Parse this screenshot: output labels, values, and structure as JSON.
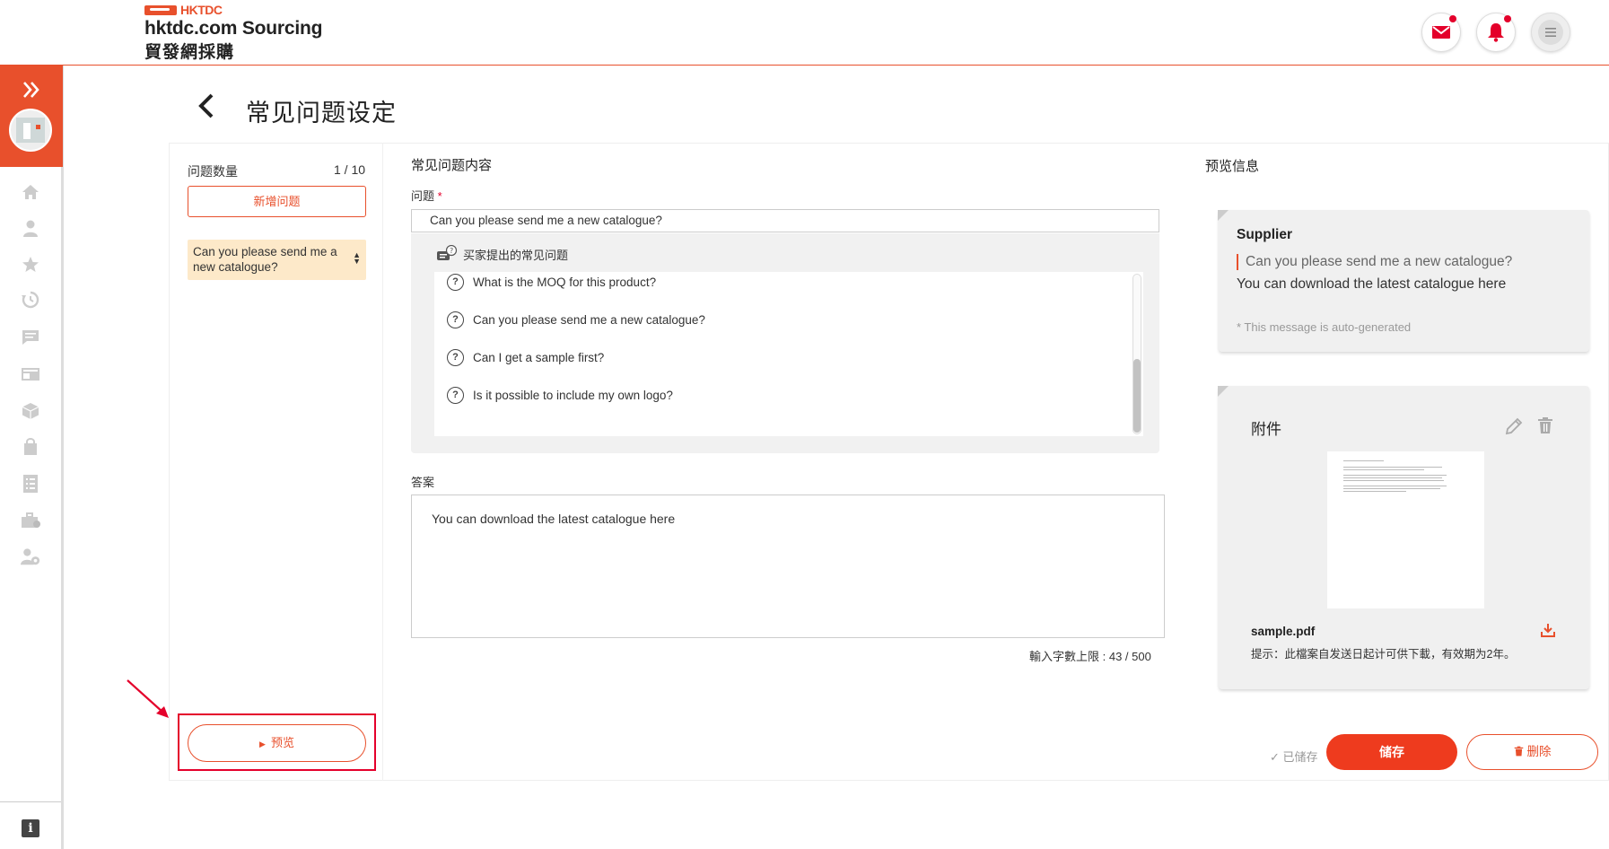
{
  "header": {
    "logo_brand": "HKTDC",
    "logo_en": "hktdc.com Sourcing",
    "logo_zh": "貿發網採購",
    "icons": [
      "mail-icon",
      "bell-icon",
      "menu-icon"
    ],
    "accent_color": "#e8502c",
    "notification_dot_color": "#e4002b"
  },
  "rail": {
    "icons": [
      "expand-icon",
      "home-icon",
      "user-icon",
      "star-icon",
      "history-icon",
      "message-icon",
      "product-icon",
      "box-icon",
      "bag-icon",
      "list-icon",
      "briefcase-icon",
      "user-settings-icon",
      "info-icon"
    ]
  },
  "page": {
    "title": "常见问题设定"
  },
  "list_panel": {
    "count_label": "问题数量",
    "count_value": "1 / 10",
    "add_button": "新增问题",
    "items": [
      {
        "label": "Can you please send me a new catalogue?"
      }
    ],
    "preview_button": "预览"
  },
  "content_panel": {
    "section_title": "常见问题内容",
    "question_label": "问题",
    "required_mark": "*",
    "question_value": "Can you please send me a new catalogue?",
    "suggest_title": "买家提出的常见问题",
    "suggestions": [
      "What is the MOQ for this product?",
      "Can you please send me a new catalogue?",
      "Can I get a sample first?",
      "Is it possible to include my own logo?"
    ],
    "answer_label": "答案",
    "answer_value": "You can download the latest catalogue here",
    "char_limit": "輸入字數上限 : 43 / 500"
  },
  "preview_panel": {
    "section_title": "预览信息",
    "supplier_label": "Supplier",
    "preview_question": "Can you please send me a new catalogue?",
    "preview_answer": "You can download the latest catalogue here",
    "auto_note": "* This message is auto-generated",
    "attachment_title": "附件",
    "file_name": "sample.pdf",
    "file_hint": "提示：此檔案自发送日起计可供下載，有效期为2年。"
  },
  "actions": {
    "saved_status": "✓ 已储存",
    "save_button": "储存",
    "delete_button": "删除"
  }
}
